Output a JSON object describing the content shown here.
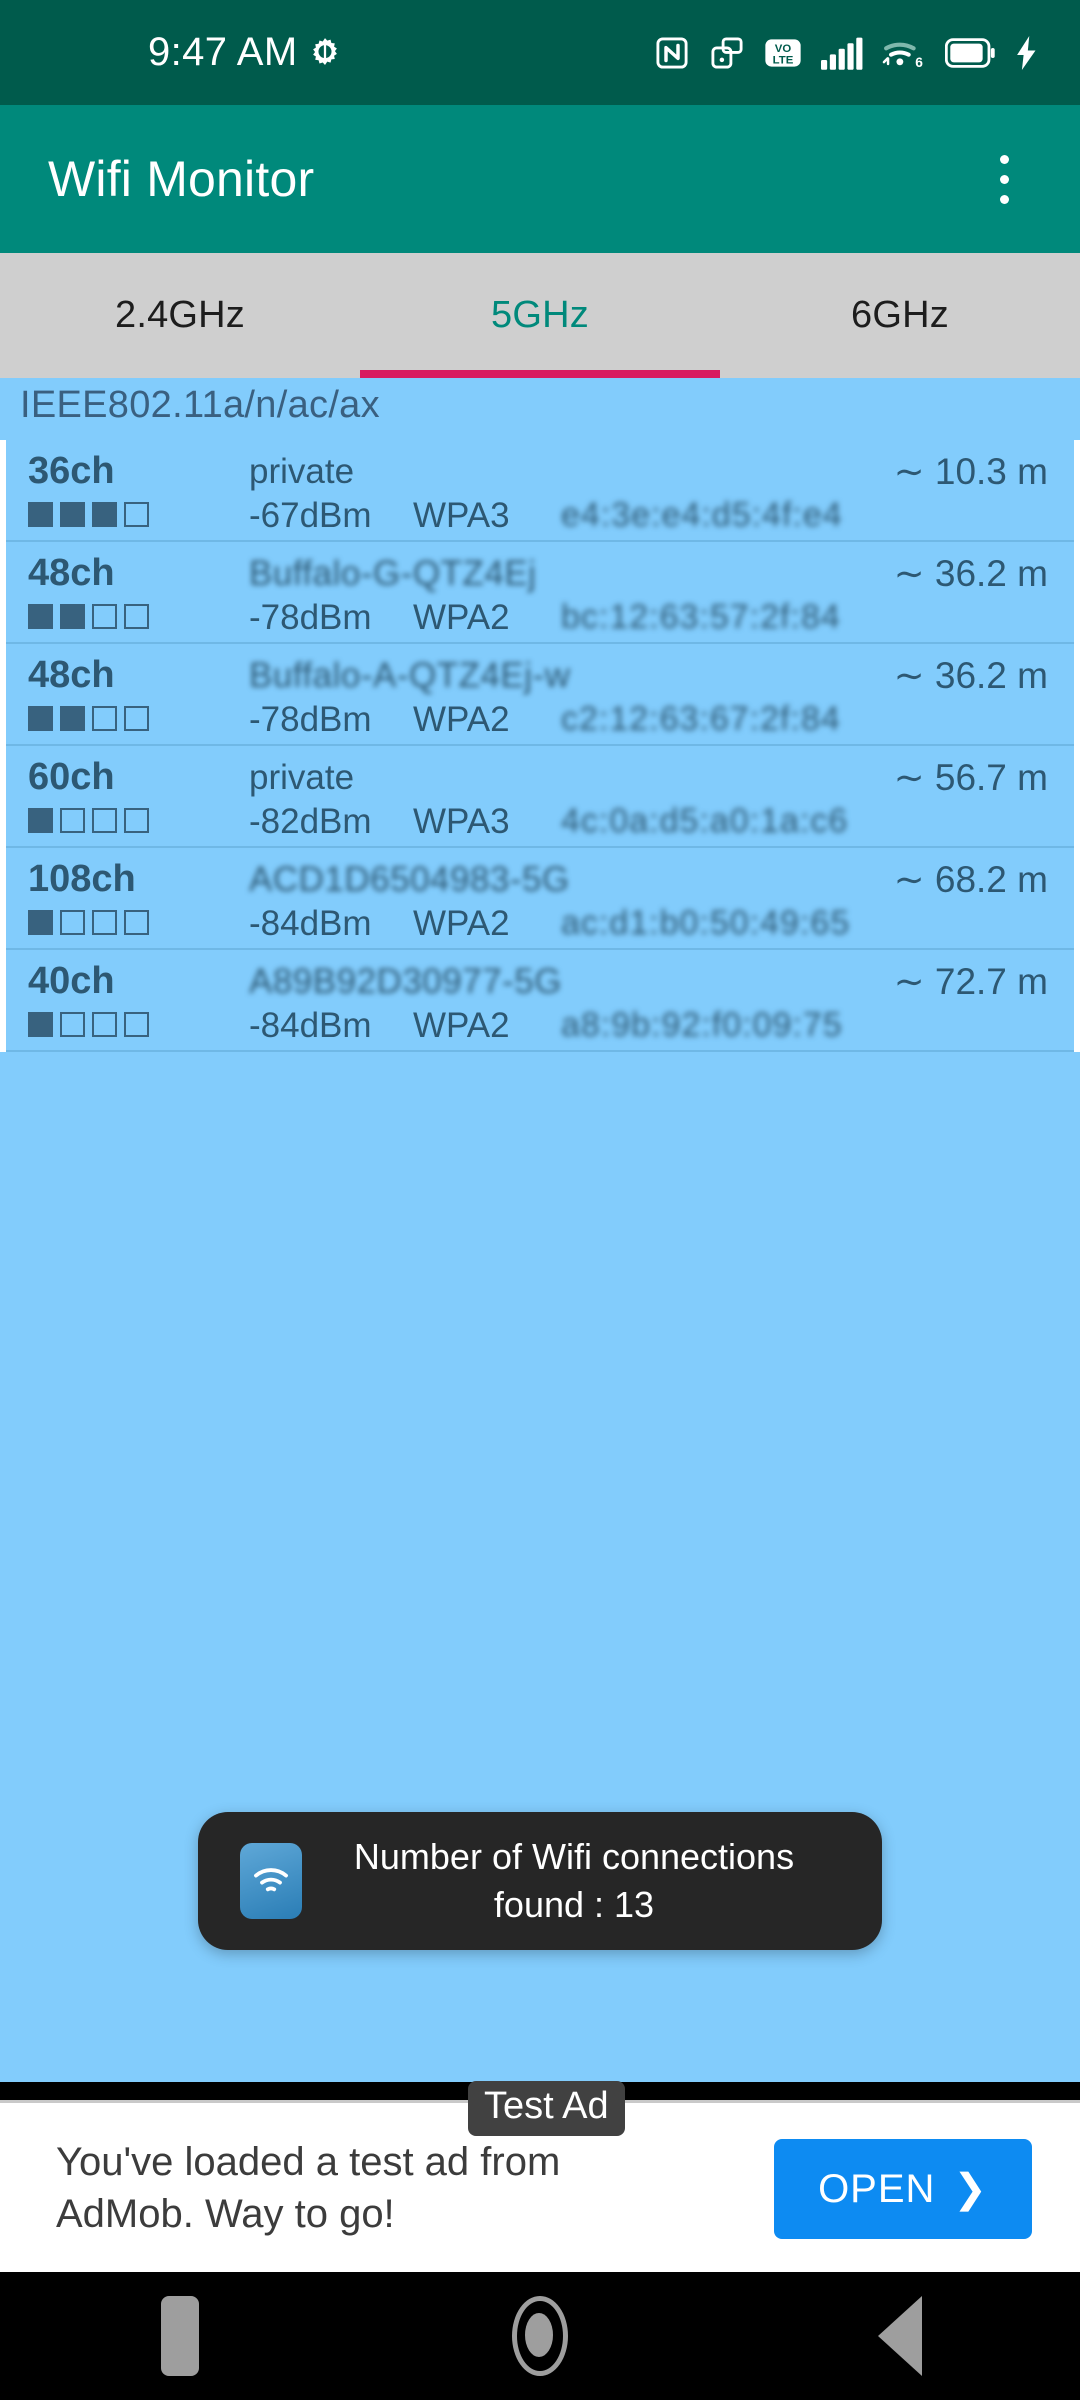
{
  "status_bar": {
    "clock": "9:47 AM",
    "left_icons": [
      "alarm-gear-icon"
    ],
    "right_icons": [
      "nfc-icon",
      "screen-cast-icon",
      "volte-icon",
      "cellular-signal-icon",
      "wifi-6-icon",
      "battery-icon",
      "charging-bolt-icon"
    ],
    "wifi_generation": "6",
    "volte_top": "VO",
    "volte_bottom": "LTE",
    "bg_color": "#005B4C"
  },
  "app_bar": {
    "title": "Wifi Monitor",
    "overflow_label": "More options",
    "bg_color": "#00897B"
  },
  "tabs": {
    "items": [
      {
        "label": "2.4GHz",
        "active": false
      },
      {
        "label": "5GHz",
        "active": true
      },
      {
        "label": "6GHz",
        "active": false
      }
    ],
    "indicator_color": "#D81B60",
    "active_color": "#00897B",
    "bg_color": "#CFCFCF"
  },
  "standard_bar": {
    "label": "IEEE802.11a/n/ac/ax"
  },
  "list": {
    "bg_color": "#82CCFC",
    "rows": [
      {
        "channel": "36ch",
        "ssid": "private",
        "ssid_blurred": false,
        "distance": "∼ 10.3 m",
        "rssi": "-67dBm",
        "security": "WPA3",
        "bssid": "e4:3e:e4:d5:4f:e4",
        "bars_on": 3,
        "bars_total": 4
      },
      {
        "channel": "48ch",
        "ssid": "Buffalo-G-QTZ4Ej",
        "ssid_blurred": true,
        "distance": "∼ 36.2 m",
        "rssi": "-78dBm",
        "security": "WPA2",
        "bssid": "bc:12:63:57:2f:84",
        "bars_on": 2,
        "bars_total": 4
      },
      {
        "channel": "48ch",
        "ssid": "Buffalo-A-QTZ4Ej-w",
        "ssid_blurred": true,
        "distance": "∼ 36.2 m",
        "rssi": "-78dBm",
        "security": "WPA2",
        "bssid": "c2:12:63:67:2f:84",
        "bars_on": 2,
        "bars_total": 4
      },
      {
        "channel": "60ch",
        "ssid": "private",
        "ssid_blurred": false,
        "distance": "∼ 56.7 m",
        "rssi": "-82dBm",
        "security": "WPA3",
        "bssid": "4c:0a:d5:a0:1a:c6",
        "bars_on": 1,
        "bars_total": 4
      },
      {
        "channel": "108ch",
        "ssid": "ACD1D6504983-5G",
        "ssid_blurred": true,
        "distance": "∼ 68.2 m",
        "rssi": "-84dBm",
        "security": "WPA2",
        "bssid": "ac:d1:b0:50:49:65",
        "bars_on": 1,
        "bars_total": 4
      },
      {
        "channel": "40ch",
        "ssid": "A89B92D30977-5G",
        "ssid_blurred": true,
        "distance": "∼ 72.7 m",
        "rssi": "-84dBm",
        "security": "WPA2",
        "bssid": "a8:9b:92:f0:09:75",
        "bars_on": 1,
        "bars_total": 4
      }
    ]
  },
  "toast": {
    "message": "Number of Wifi connections found : 13",
    "icon": "wifi-app-icon",
    "count": "13"
  },
  "ad": {
    "badge": "Test Ad",
    "body": "You've loaded a test ad from AdMob. Way to go!",
    "cta": "OPEN",
    "cta_chevron": "❯",
    "cta_color": "#0D8BF2"
  },
  "nav_bar": {
    "buttons": [
      {
        "name": "recents",
        "label": "Recents"
      },
      {
        "name": "home",
        "label": "Home"
      },
      {
        "name": "back",
        "label": "Back"
      }
    ]
  }
}
